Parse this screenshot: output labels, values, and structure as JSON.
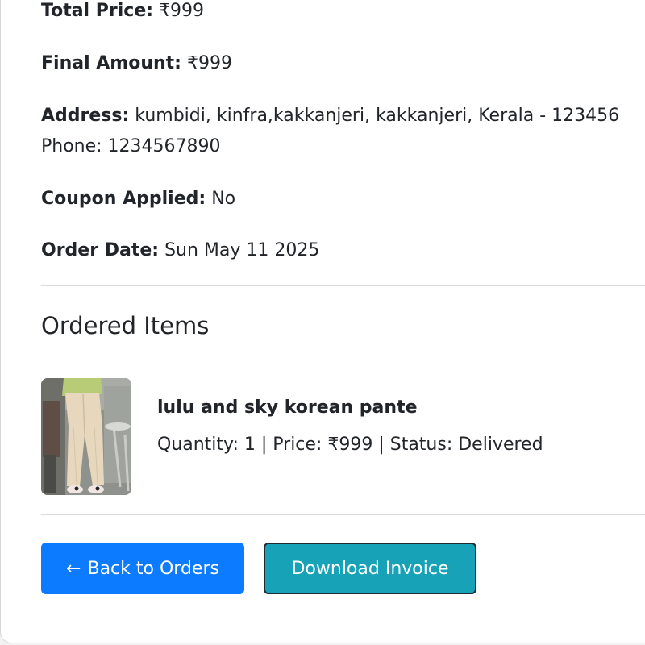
{
  "order": {
    "total_price_label": "Total Price:",
    "total_price_value": "₹999",
    "final_amount_label": "Final Amount:",
    "final_amount_value": "₹999",
    "address_label": "Address:",
    "address_value": "kumbidi, kinfra,kakkanjeri, kakkanjeri, Kerala - 123456",
    "phone_text": "Phone: 1234567890",
    "coupon_label": "Coupon Applied:",
    "coupon_value": "No",
    "order_date_label": "Order Date:",
    "order_date_value": "Sun May 11 2025"
  },
  "items_section": {
    "title": "Ordered Items",
    "items": [
      {
        "name": "lulu and sky korean pante",
        "meta": "Quantity: 1 | Price: ₹999 | Status: Delivered",
        "image_icon": "product-photo-icon"
      }
    ]
  },
  "actions": {
    "back_arrow": "←",
    "back_label": "Back to Orders",
    "invoice_label": "Download Invoice"
  },
  "colors": {
    "back_button": "#0d7bff",
    "invoice_button": "#17a2b8"
  }
}
